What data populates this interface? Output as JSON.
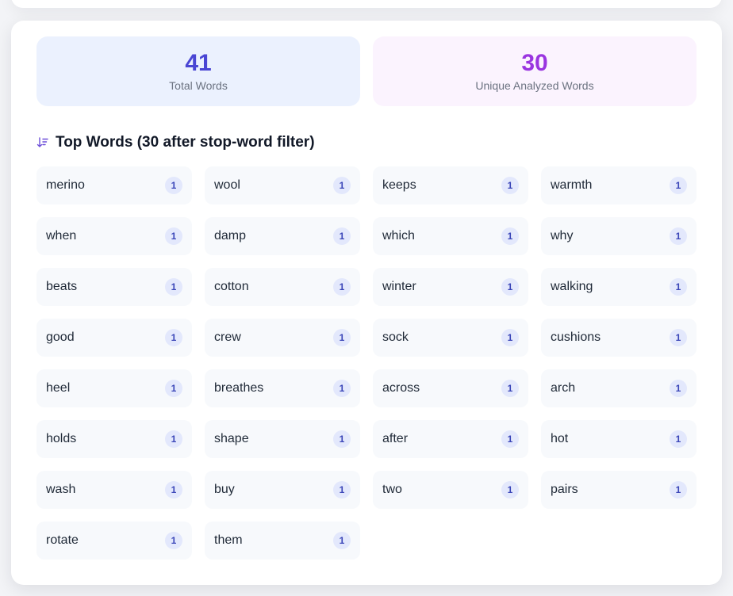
{
  "stats": {
    "total": {
      "value": "41",
      "label": "Total Words"
    },
    "unique": {
      "value": "30",
      "label": "Unique Analyzed Words"
    }
  },
  "section": {
    "title": "Top Words (30 after stop-word filter)",
    "icon": "sort-descending-icon"
  },
  "colors": {
    "total_accent": "#4a46d4",
    "unique_accent": "#9a35e0",
    "badge_bg": "#e3e8fc",
    "badge_text": "#3b46b8"
  },
  "words": [
    {
      "word": "merino",
      "count": "1"
    },
    {
      "word": "wool",
      "count": "1"
    },
    {
      "word": "keeps",
      "count": "1"
    },
    {
      "word": "warmth",
      "count": "1"
    },
    {
      "word": "when",
      "count": "1"
    },
    {
      "word": "damp",
      "count": "1"
    },
    {
      "word": "which",
      "count": "1"
    },
    {
      "word": "why",
      "count": "1"
    },
    {
      "word": "beats",
      "count": "1"
    },
    {
      "word": "cotton",
      "count": "1"
    },
    {
      "word": "winter",
      "count": "1"
    },
    {
      "word": "walking",
      "count": "1"
    },
    {
      "word": "good",
      "count": "1"
    },
    {
      "word": "crew",
      "count": "1"
    },
    {
      "word": "sock",
      "count": "1"
    },
    {
      "word": "cushions",
      "count": "1"
    },
    {
      "word": "heel",
      "count": "1"
    },
    {
      "word": "breathes",
      "count": "1"
    },
    {
      "word": "across",
      "count": "1"
    },
    {
      "word": "arch",
      "count": "1"
    },
    {
      "word": "holds",
      "count": "1"
    },
    {
      "word": "shape",
      "count": "1"
    },
    {
      "word": "after",
      "count": "1"
    },
    {
      "word": "hot",
      "count": "1"
    },
    {
      "word": "wash",
      "count": "1"
    },
    {
      "word": "buy",
      "count": "1"
    },
    {
      "word": "two",
      "count": "1"
    },
    {
      "word": "pairs",
      "count": "1"
    },
    {
      "word": "rotate",
      "count": "1"
    },
    {
      "word": "them",
      "count": "1"
    }
  ]
}
